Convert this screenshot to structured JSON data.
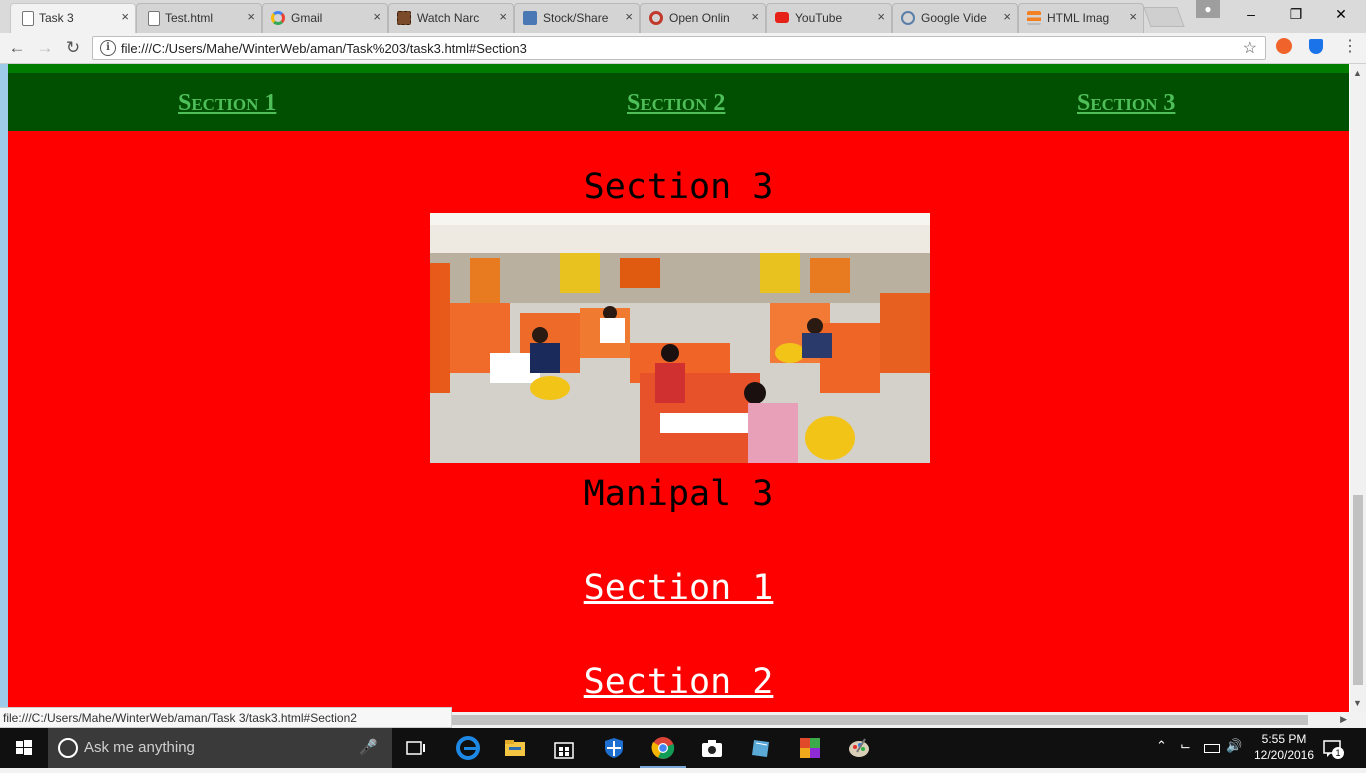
{
  "browser": {
    "tabs": [
      {
        "title": "Task 3",
        "favicon": "page-icon",
        "active": true
      },
      {
        "title": "Test.html",
        "favicon": "page-icon",
        "active": false
      },
      {
        "title": "Gmail",
        "favicon": "google-icon",
        "active": false
      },
      {
        "title": "Watch Narc",
        "favicon": "film-icon",
        "active": false
      },
      {
        "title": "Stock/Share",
        "favicon": "chart-icon",
        "active": false
      },
      {
        "title": "Open Onlin",
        "favicon": "ring-icon",
        "active": false
      },
      {
        "title": "YouTube",
        "favicon": "youtube-icon",
        "active": false
      },
      {
        "title": "Google Vide",
        "favicon": "compass-icon",
        "active": false
      },
      {
        "title": "HTML Imag",
        "favicon": "stack-icon",
        "active": false
      }
    ],
    "close_glyph": "×",
    "address": "file:///C:/Users/Mahe/WinterWeb/aman/Task%203/task3.html#Section3",
    "status_url": "file:///C:/Users/Mahe/WinterWeb/aman/Task 3/task3.html#Section2",
    "window_controls": {
      "minimize": "–",
      "maximize": "❐",
      "close": "✕"
    }
  },
  "page": {
    "nav_links": [
      "Section 1",
      "Section 2",
      "Section 3"
    ],
    "heading": "Section 3",
    "caption": "Manipal 3",
    "links": [
      "Section 1",
      "Section 2"
    ],
    "colors": {
      "nav_bg": "#014f00",
      "nav_top": "#007c00",
      "nav_link": "#4fbf5a",
      "content_bg": "#ff0000"
    }
  },
  "taskbar": {
    "search_placeholder": "Ask me anything",
    "clock_time": "5:55 PM",
    "clock_date": "12/20/2016",
    "notification_count": "1"
  }
}
